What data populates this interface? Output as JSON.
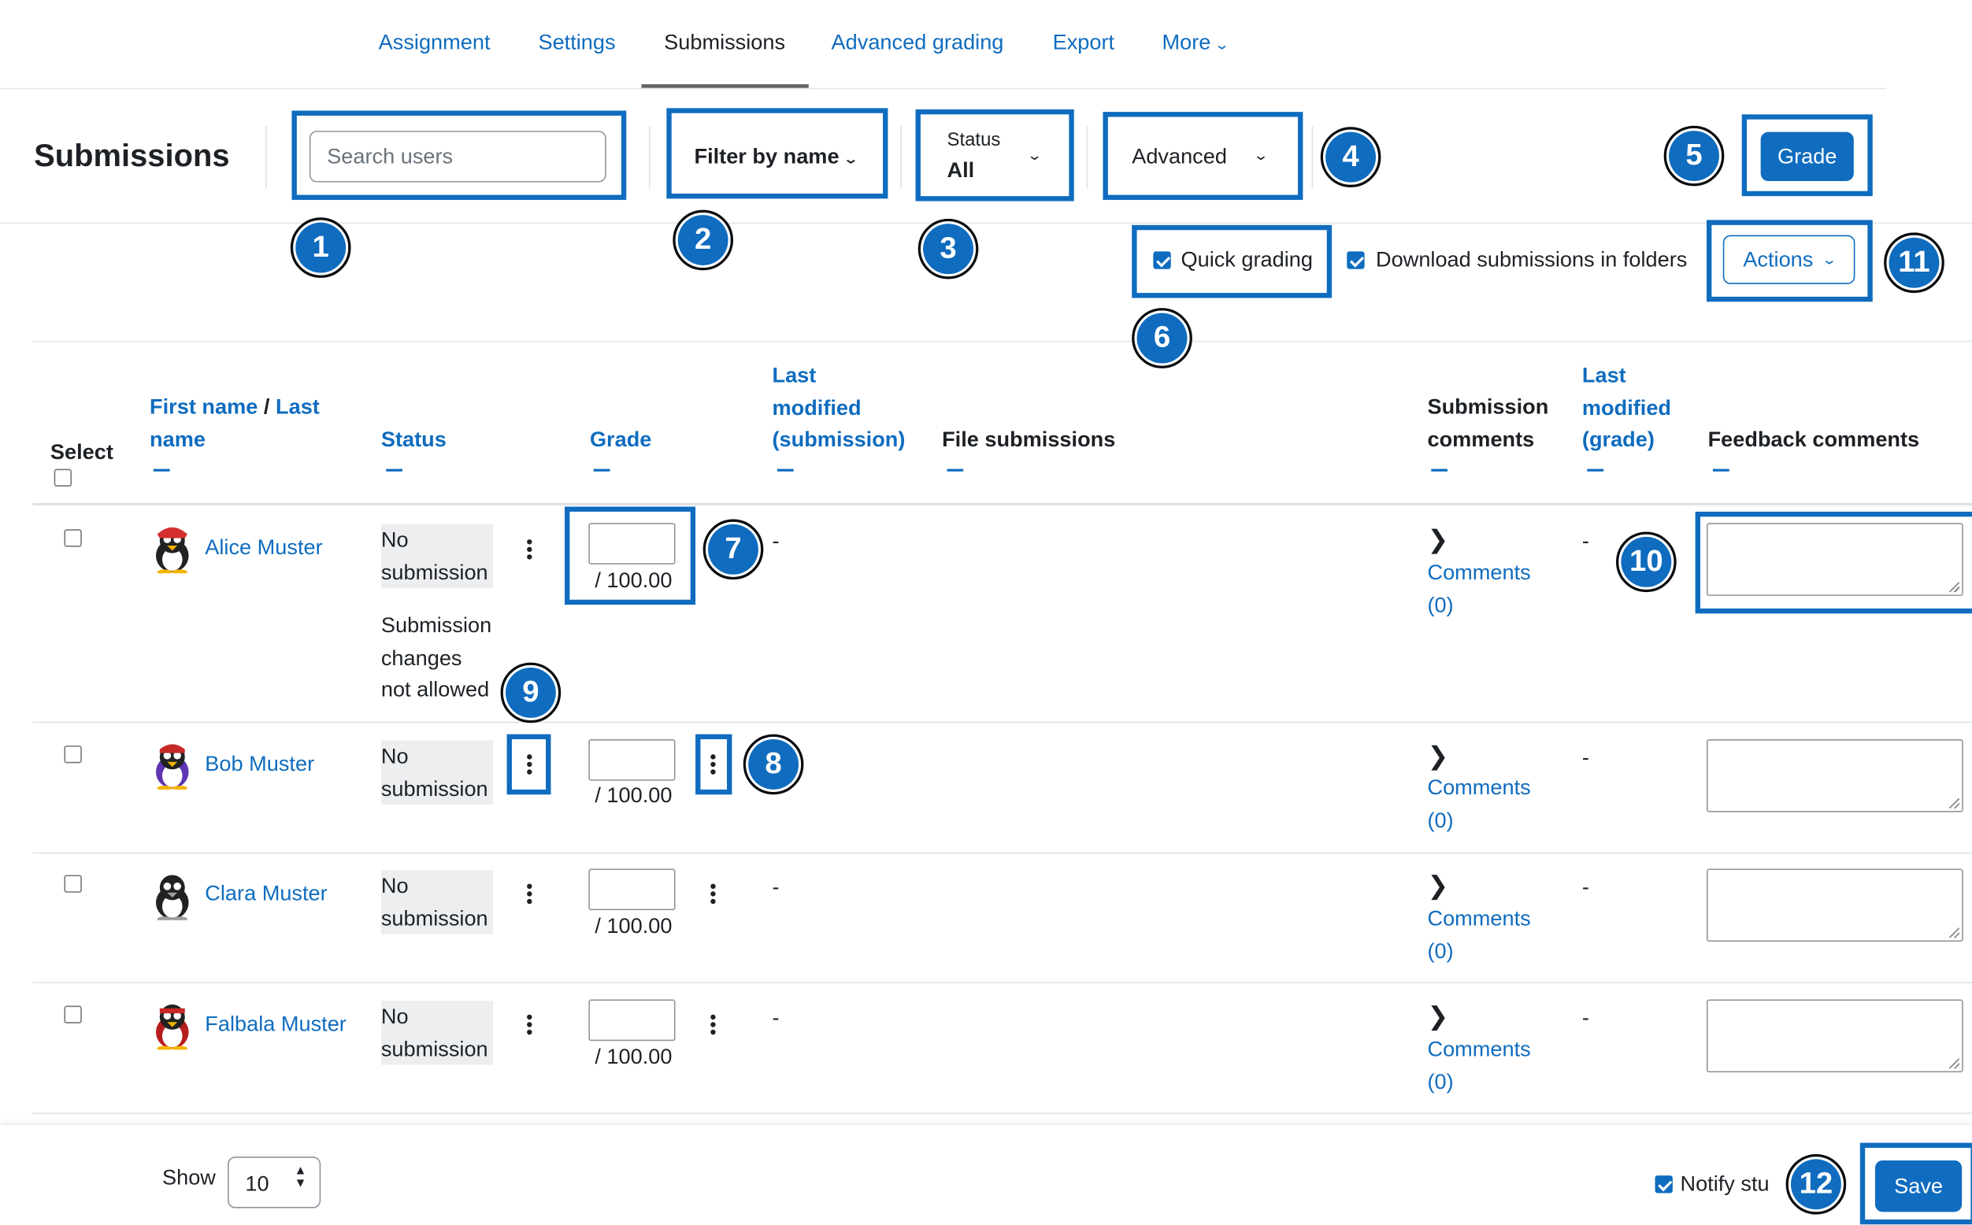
{
  "tabs": [
    {
      "label": "Assignment"
    },
    {
      "label": "Settings"
    },
    {
      "label": "Submissions"
    },
    {
      "label": "Advanced grading"
    },
    {
      "label": "Export"
    },
    {
      "label": "More"
    }
  ],
  "header": {
    "title": "Submissions",
    "search_placeholder": "Search users",
    "filter_by_name": "Filter by name",
    "status_label": "Status",
    "status_value": "All",
    "advanced": "Advanced",
    "grade_button": "Grade"
  },
  "options": {
    "quick_grading": "Quick grading",
    "download_folders": "Download submissions in folders",
    "actions": "Actions"
  },
  "columns": {
    "select": "Select",
    "first_name": "First name",
    "slash": "/",
    "last_name_1": "Last",
    "last_name_2": "name",
    "status": "Status",
    "grade": "Grade",
    "last_modified_sub_1": "Last",
    "last_modified_sub_2": "modified",
    "last_modified_sub_3": "(submission)",
    "file_submissions": "File submissions",
    "submission_comments_1": "Submission",
    "submission_comments_2": "comments",
    "last_modified_grade_1": "Last",
    "last_modified_grade_2": "modified",
    "last_modified_grade_3": "(grade)",
    "feedback_comments": "Feedback comments"
  },
  "rows": [
    {
      "name": "Alice Muster",
      "status_1": "No",
      "status_2": "submission",
      "extra_1": "Submission",
      "extra_2": "changes",
      "extra_3": "not allowed",
      "grade_max": "/ 100.00",
      "modified_sub": "-",
      "comments_1": "Comments",
      "comments_2": "(0)",
      "modified_grade": "-"
    },
    {
      "name": "Bob Muster",
      "status_1": "No",
      "status_2": "submission",
      "grade_max": "/ 100.00",
      "modified_sub": "",
      "comments_1": "Comments",
      "comments_2": "(0)",
      "modified_grade": "-"
    },
    {
      "name": "Clara Muster",
      "status_1": "No",
      "status_2": "submission",
      "grade_max": "/ 100.00",
      "modified_sub": "-",
      "comments_1": "Comments",
      "comments_2": "(0)",
      "modified_grade": "-"
    },
    {
      "name": "Falbala Muster",
      "status_1": "No",
      "status_2": "submission",
      "grade_max": "/ 100.00",
      "modified_sub": "-",
      "comments_1": "Comments",
      "comments_2": "(0)",
      "modified_grade": "-"
    }
  ],
  "footer": {
    "show_label": "Show",
    "per_page": "10",
    "notify_label": "Notify stu",
    "save": "Save"
  },
  "callouts": [
    "1",
    "2",
    "3",
    "4",
    "5",
    "6",
    "7",
    "8",
    "9",
    "10",
    "11",
    "12"
  ],
  "colors": {
    "accent": "#0f6cbf",
    "text": "#1d2125"
  }
}
